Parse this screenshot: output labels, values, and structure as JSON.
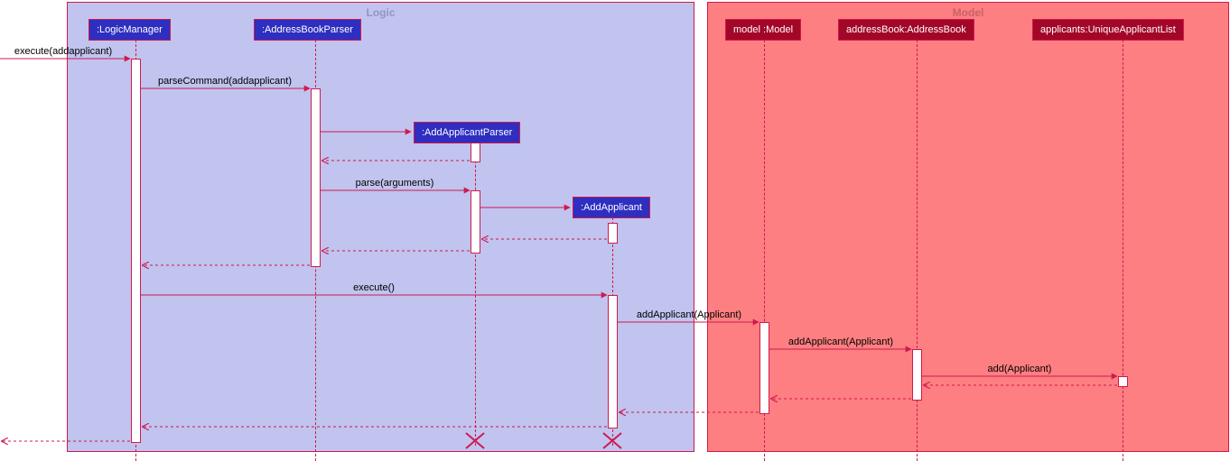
{
  "frames": {
    "logic": {
      "title": "Logic"
    },
    "model": {
      "title": "Model"
    }
  },
  "participants": {
    "logicManager": {
      "label": ":LogicManager"
    },
    "addressBookParser": {
      "label": ":AddressBookParser"
    },
    "addApplicantParser": {
      "label": ":AddApplicantParser"
    },
    "addApplicant": {
      "label": ":AddApplicant"
    },
    "modelModel": {
      "label": "model :Model"
    },
    "addressBook": {
      "label": "addressBook:AddressBook"
    },
    "applicants": {
      "label": "applicants:UniqueApplicantList"
    }
  },
  "messages": {
    "m1": "execute(addapplicant)",
    "m2": "parseCommand(addapplicant)",
    "m3": "parse(arguments)",
    "m4": "execute()",
    "m5": "addApplicant(Applicant)",
    "m6": "addApplicant(Applicant)",
    "m7": "add(Applicant)"
  },
  "chart_data": {
    "type": "sequence_diagram",
    "frames": [
      {
        "name": "Logic",
        "participants": [
          ":LogicManager",
          ":AddressBookParser",
          ":AddApplicantParser",
          ":AddApplicant"
        ]
      },
      {
        "name": "Model",
        "participants": [
          "model :Model",
          "addressBook:AddressBook",
          "applicants:UniqueApplicantList"
        ]
      }
    ],
    "messages": [
      {
        "from": "caller",
        "to": ":LogicManager",
        "label": "execute(addapplicant)",
        "type": "call"
      },
      {
        "from": ":LogicManager",
        "to": ":AddressBookParser",
        "label": "parseCommand(addapplicant)",
        "type": "call"
      },
      {
        "from": ":AddressBookParser",
        "to": ":AddApplicantParser",
        "label": "",
        "type": "create"
      },
      {
        "from": ":AddApplicantParser",
        "to": ":AddressBookParser",
        "label": "",
        "type": "return"
      },
      {
        "from": ":AddressBookParser",
        "to": ":AddApplicantParser",
        "label": "parse(arguments)",
        "type": "call"
      },
      {
        "from": ":AddApplicantParser",
        "to": ":AddApplicant",
        "label": "",
        "type": "create"
      },
      {
        "from": ":AddApplicant",
        "to": ":AddApplicantParser",
        "label": "",
        "type": "return"
      },
      {
        "from": ":AddApplicantParser",
        "to": ":AddressBookParser",
        "label": "",
        "type": "return"
      },
      {
        "from": ":AddressBookParser",
        "to": ":LogicManager",
        "label": "",
        "type": "return"
      },
      {
        "from": ":LogicManager",
        "to": ":AddApplicant",
        "label": "execute()",
        "type": "call"
      },
      {
        "from": ":AddApplicant",
        "to": "model :Model",
        "label": "addApplicant(Applicant)",
        "type": "call"
      },
      {
        "from": "model :Model",
        "to": "addressBook:AddressBook",
        "label": "addApplicant(Applicant)",
        "type": "call"
      },
      {
        "from": "addressBook:AddressBook",
        "to": "applicants:UniqueApplicantList",
        "label": "add(Applicant)",
        "type": "call"
      },
      {
        "from": "applicants:UniqueApplicantList",
        "to": "addressBook:AddressBook",
        "label": "",
        "type": "return"
      },
      {
        "from": "addressBook:AddressBook",
        "to": "model :Model",
        "label": "",
        "type": "return"
      },
      {
        "from": "model :Model",
        "to": ":AddApplicant",
        "label": "",
        "type": "return"
      },
      {
        "from": ":AddApplicant",
        "to": ":LogicManager",
        "label": "",
        "type": "return"
      },
      {
        "from": ":LogicManager",
        "to": "caller",
        "label": "",
        "type": "return"
      }
    ],
    "destroyed": [
      ":AddApplicantParser",
      ":AddApplicant"
    ]
  }
}
